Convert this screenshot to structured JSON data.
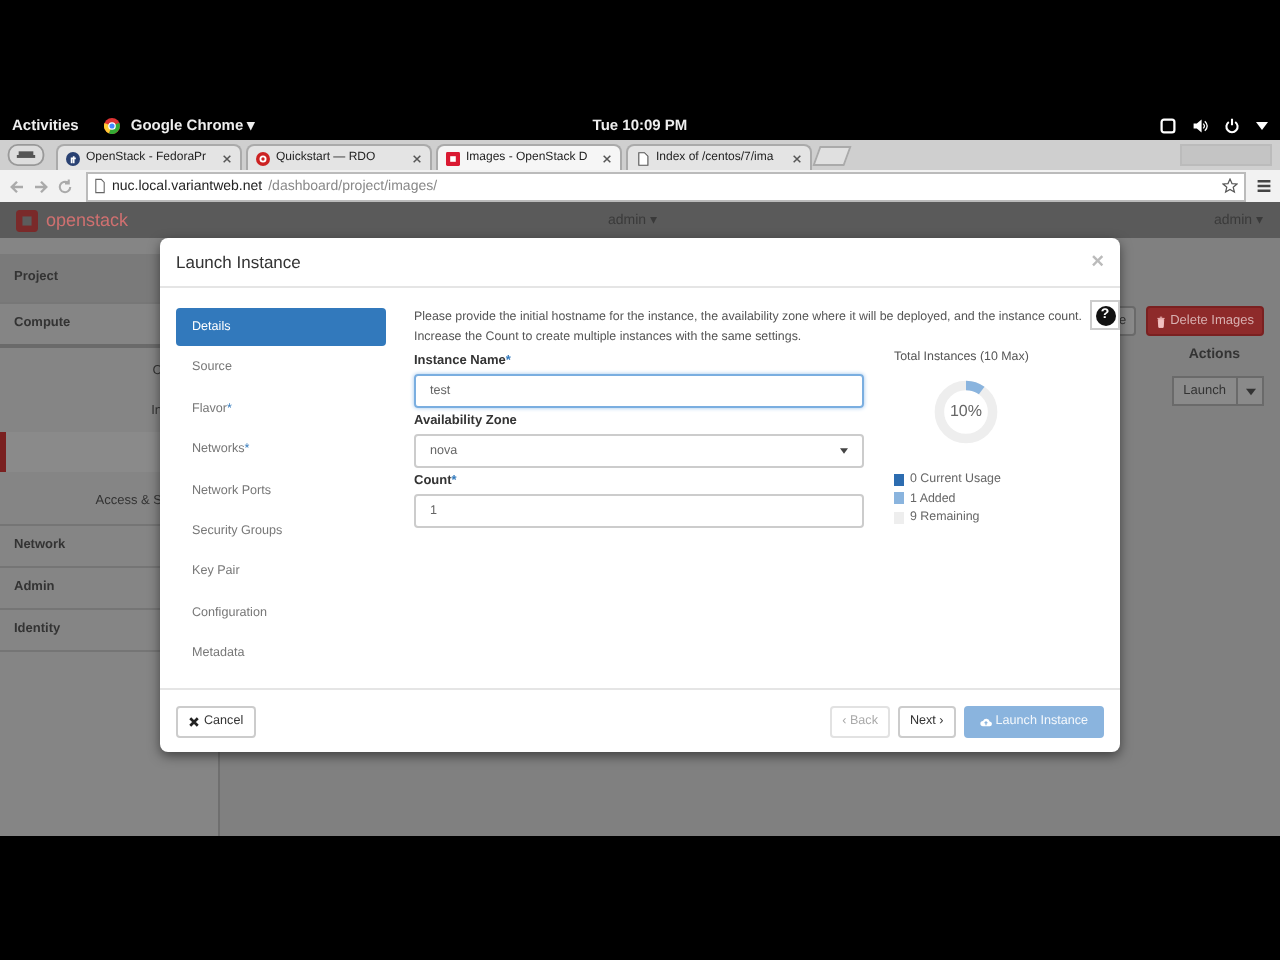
{
  "system_bar": {
    "activities": "Activities",
    "app_menu": "Google Chrome ▾",
    "clock": "Tue 10:09 PM"
  },
  "browser": {
    "tabs": [
      {
        "title": "OpenStack - FedoraPr",
        "selected": false,
        "kind": "fedora"
      },
      {
        "title": "Quickstart — RDO",
        "selected": false,
        "kind": "rdo"
      },
      {
        "title": "Images - OpenStack D",
        "selected": true,
        "kind": "openstack"
      },
      {
        "title": "Index of /centos/7/ima",
        "selected": false,
        "kind": "page"
      }
    ],
    "address": {
      "host": "nuc.local.variantweb.net",
      "path": "/dashboard/project/images/"
    }
  },
  "header": {
    "brand": "openstack",
    "project_menu": "admin ▾",
    "user_menu": "admin ▾"
  },
  "sidebar": [
    {
      "label": "Project",
      "kind": "section"
    },
    {
      "label": "Compute",
      "kind": "group"
    },
    {
      "label": "C",
      "kind": "item",
      "selected": false
    },
    {
      "label": "In",
      "kind": "item",
      "selected": false
    },
    {
      "kind": "item",
      "selected": true
    },
    {
      "label": "Access & S",
      "kind": "subgroup"
    },
    {
      "label": "Network",
      "kind": "section"
    },
    {
      "label": "Admin",
      "kind": "section"
    },
    {
      "label": "Identity",
      "kind": "section"
    }
  ],
  "images_page": {
    "buttons": [
      {
        "label": "e",
        "kind": "default"
      },
      {
        "label": "Delete Images",
        "kind": "danger"
      }
    ],
    "actions_header": "Actions",
    "row_action": "Launch"
  },
  "modal": {
    "title": "Launch Instance",
    "close": "×",
    "help": "?",
    "steps": [
      {
        "label": "Details",
        "selected": true
      },
      {
        "label": "Source",
        "selected": false
      },
      {
        "label": "Flavor",
        "required_mark": "*",
        "selected": false
      },
      {
        "label": "Networks",
        "required_mark": "*",
        "selected": false
      },
      {
        "label": "Network Ports",
        "selected": false
      },
      {
        "label": "Security Groups",
        "selected": false
      },
      {
        "label": "Key Pair",
        "selected": false
      },
      {
        "label": "Configuration",
        "selected": false
      },
      {
        "label": "Metadata",
        "selected": false
      }
    ],
    "description": "Please provide the initial hostname for the instance, the availability zone where it will be deployed, and the instance count. Increase the Count to create multiple instances with the same settings.",
    "fields": [
      {
        "label": "Instance Name",
        "required_mark": "*",
        "kind": "text",
        "value": "test",
        "focused": true
      },
      {
        "label": "Availability Zone",
        "kind": "select",
        "value": "nova",
        "focused": false
      },
      {
        "label": "Count",
        "required_mark": "*",
        "kind": "text",
        "value": "1",
        "focused": false
      }
    ],
    "quota": {
      "title": "Total Instances (10 Max)",
      "level": 0.1,
      "reading": "10%",
      "legend": [
        {
          "label": "0 Current Usage",
          "color": "#2c6cb0"
        },
        {
          "label": "1 Added",
          "color": "#8ab4de"
        },
        {
          "label": "9 Remaining",
          "color": "#eeeeee"
        }
      ]
    },
    "footer_buttons": [
      {
        "label": "Cancel",
        "kind": "cancel",
        "disabled": false
      },
      {
        "label": "‹ Back",
        "kind": "default",
        "disabled": true
      },
      {
        "label": "Next ›",
        "kind": "default",
        "disabled": false
      },
      {
        "label": "Launch Instance",
        "kind": "primary",
        "disabled": true
      }
    ]
  }
}
